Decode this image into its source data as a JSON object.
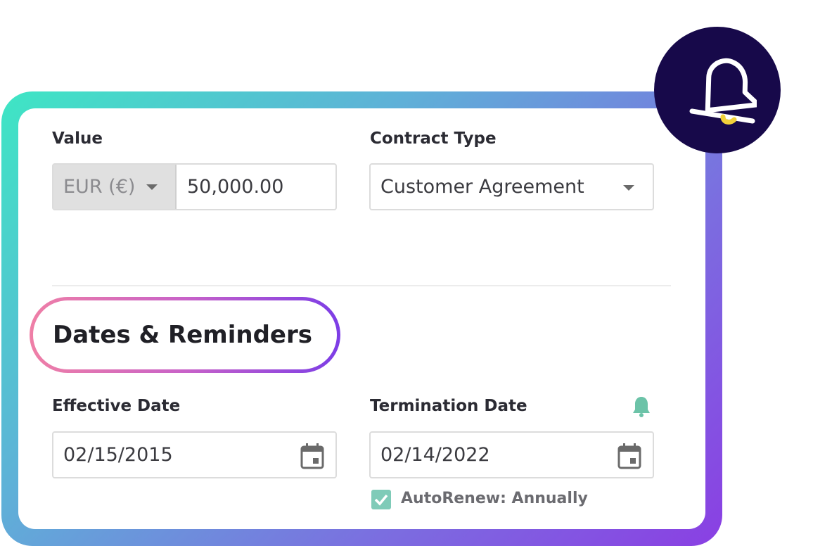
{
  "value": {
    "label": "Value",
    "currency": "EUR (€)",
    "amount": "50,000.00"
  },
  "contract_type": {
    "label": "Contract Type",
    "selected": "Customer Agreement"
  },
  "section": {
    "title": "Dates & Reminders"
  },
  "effective_date": {
    "label": "Effective Date",
    "value": "02/15/2015"
  },
  "termination_date": {
    "label": "Termination Date",
    "value": "02/14/2022",
    "reminder_icon": "bell-icon"
  },
  "autorenew": {
    "label": "AutoRenew: Annually",
    "checked": true
  },
  "colors": {
    "brand_dark": "#17094a",
    "accent_yellow": "#f2d13a",
    "teal": "#6cc3a8",
    "gradient_start": "#3ee6c4",
    "gradient_end": "#8a3fe3"
  }
}
